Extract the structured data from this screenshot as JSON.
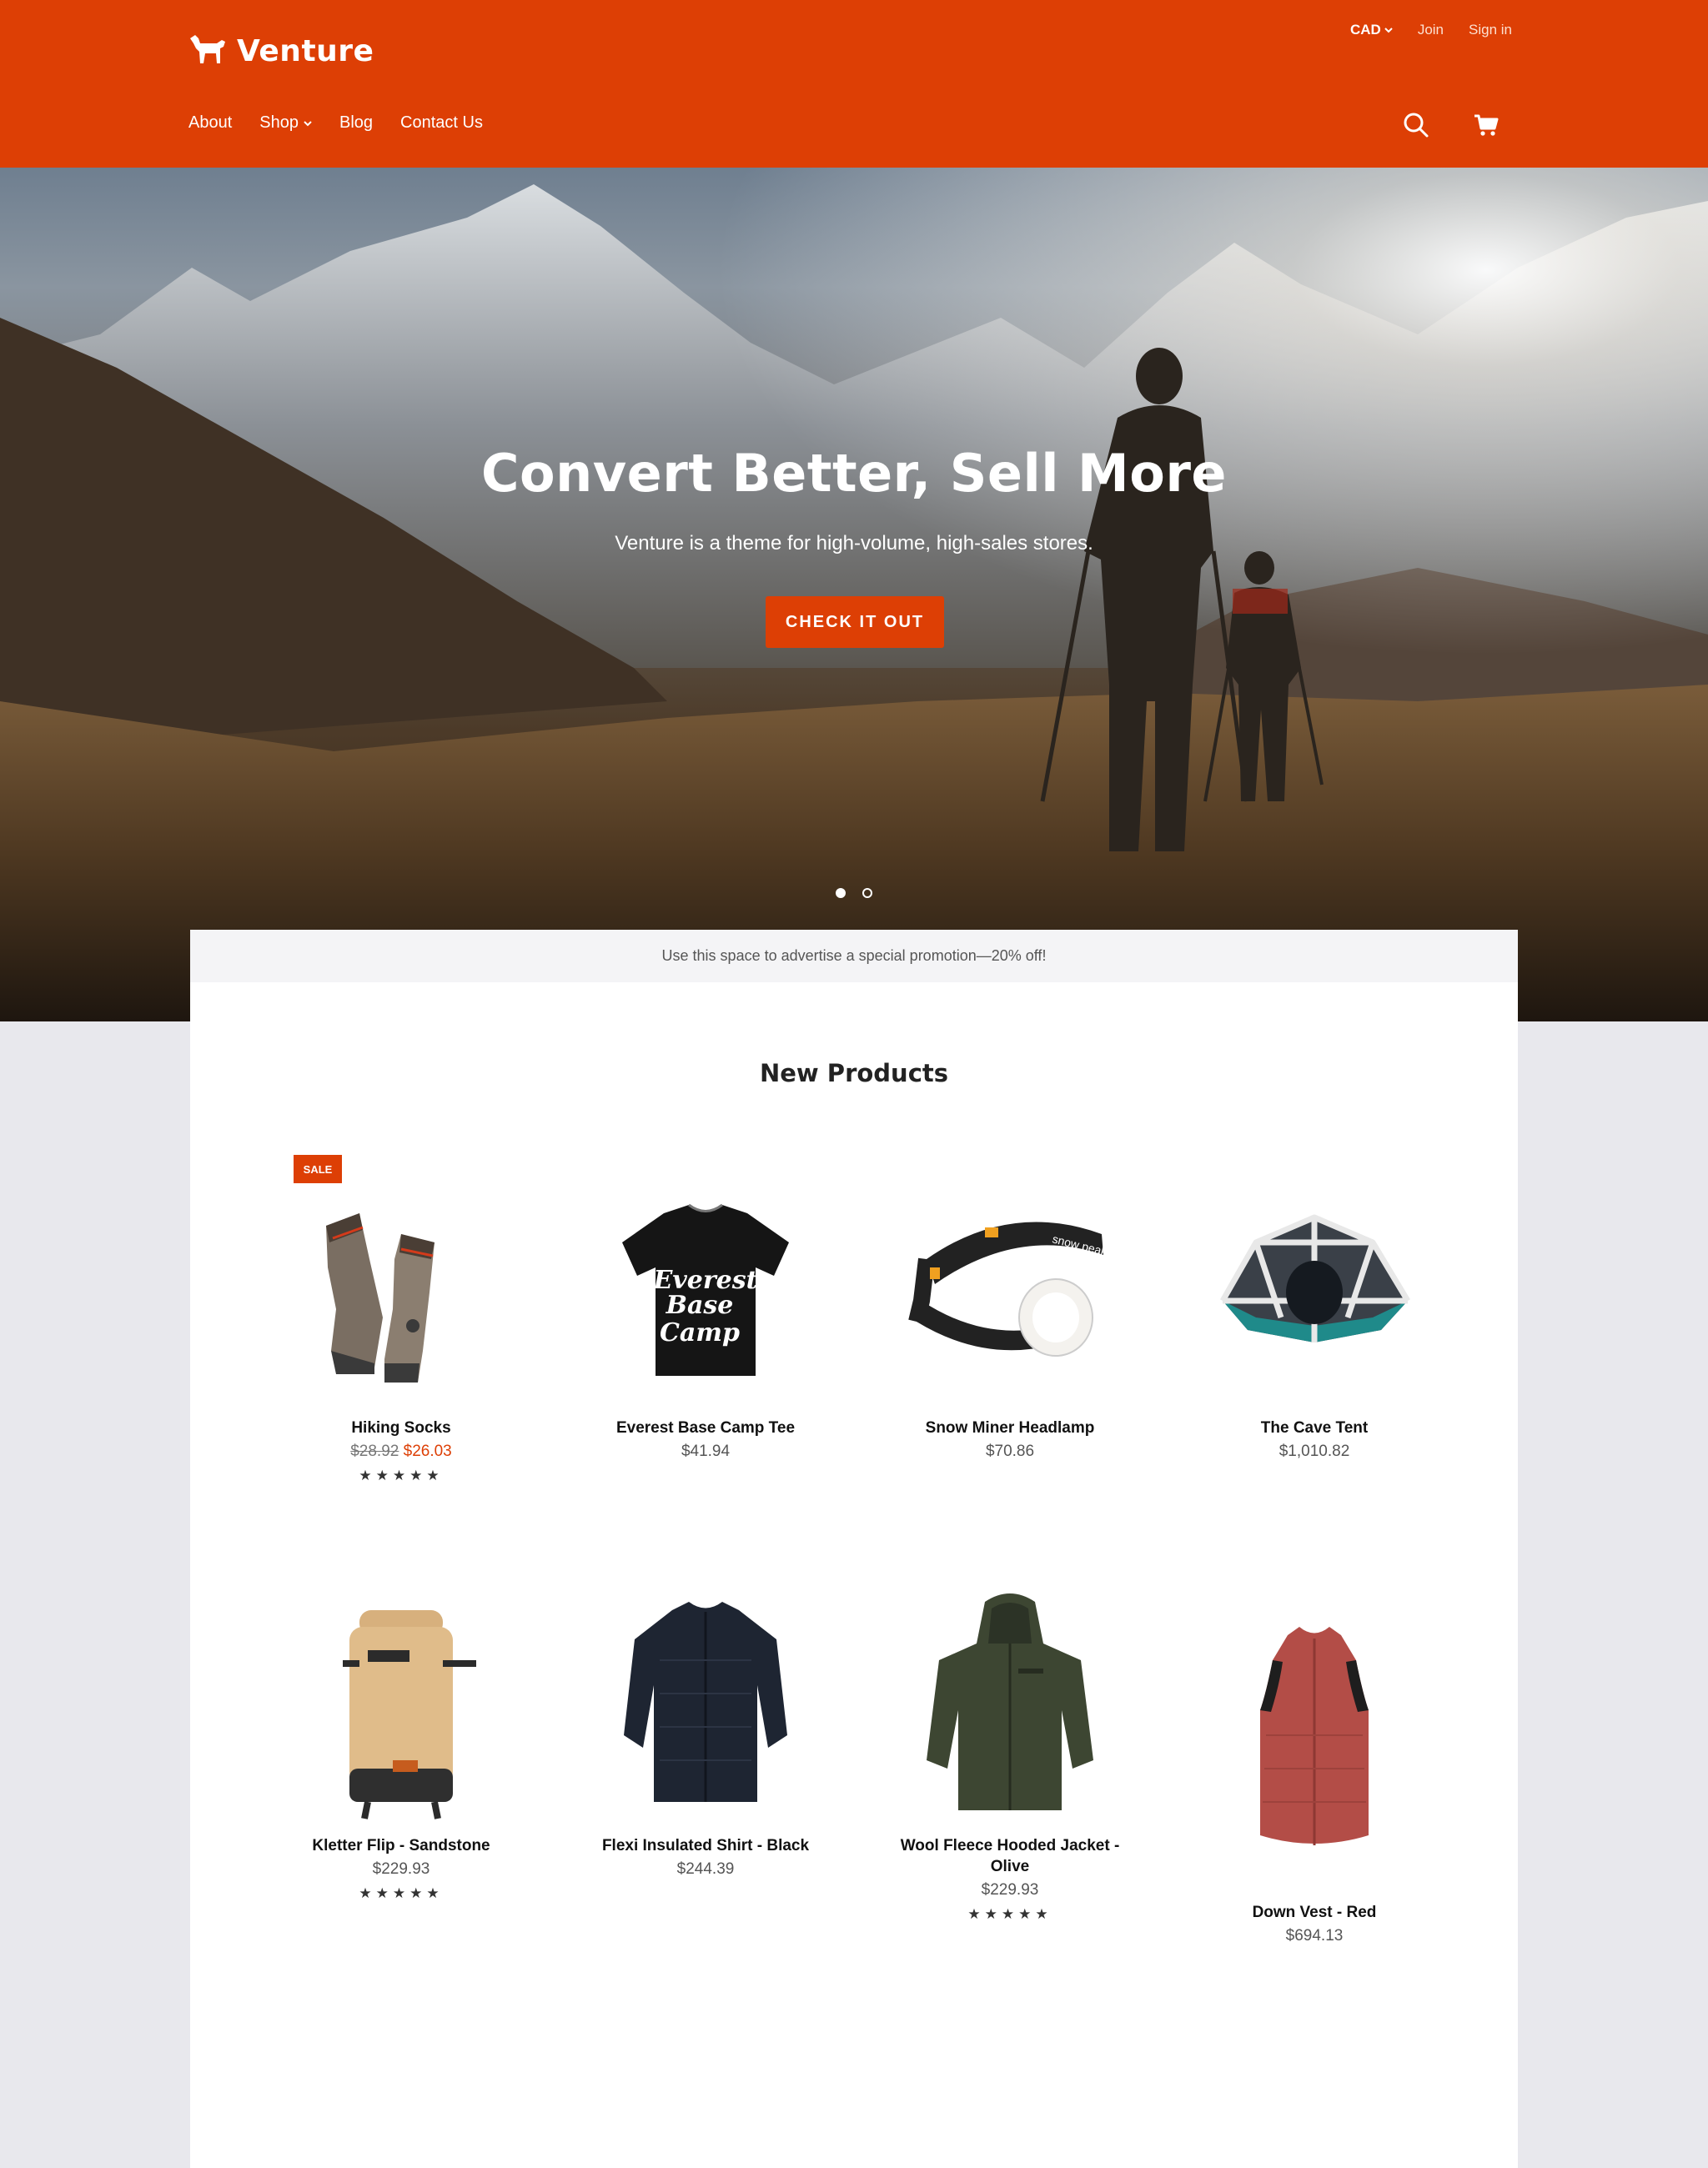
{
  "brand": {
    "name": "Venture"
  },
  "top_bar": {
    "currency": "CAD",
    "join": "Join",
    "sign_in": "Sign in"
  },
  "nav": {
    "about": "About",
    "shop": "Shop",
    "blog": "Blog",
    "contact": "Contact Us"
  },
  "icons": {
    "logo": "dog-logo-icon",
    "search": "search-icon",
    "cart": "cart-icon",
    "chevron": "chevron-down-icon"
  },
  "hero": {
    "title": "Convert Better, Sell More",
    "subtitle": "Venture is a theme for high-volume, high-sales stores.",
    "button": "CHECK IT OUT",
    "slides": 2,
    "active_slide": 1
  },
  "promo": {
    "text": "Use this space to advertise a special promotion—20% off!"
  },
  "products_section": {
    "title": "New Products",
    "sale_badge": "SALE",
    "products": [
      {
        "name": "Hiking Socks",
        "old_price": "$28.92",
        "price": "$26.03",
        "stars": "★★★★★"
      },
      {
        "name": "Everest Base Camp Tee",
        "price": "$41.94"
      },
      {
        "name": "Snow Miner Headlamp",
        "price": "$70.86"
      },
      {
        "name": "The Cave Tent",
        "price": "$1,010.82"
      },
      {
        "name": "Kletter Flip - Sandstone",
        "price": "$229.93",
        "stars": "★★★★★"
      },
      {
        "name": "Flexi Insulated Shirt - Black",
        "price": "$244.39"
      },
      {
        "name": "Wool Fleece Hooded Jacket - Olive",
        "price": "$229.93",
        "stars": "★★★★★"
      },
      {
        "name": "Down Vest - Red",
        "price": "$694.13"
      }
    ],
    "tee_print": [
      "Everest",
      "Base",
      "Camp"
    ],
    "headlamp_print": "snow peak"
  },
  "colors": {
    "accent": "#dd3f05",
    "promo_bg": "#f4f4f6",
    "page_bg": "#e8e8ed"
  }
}
